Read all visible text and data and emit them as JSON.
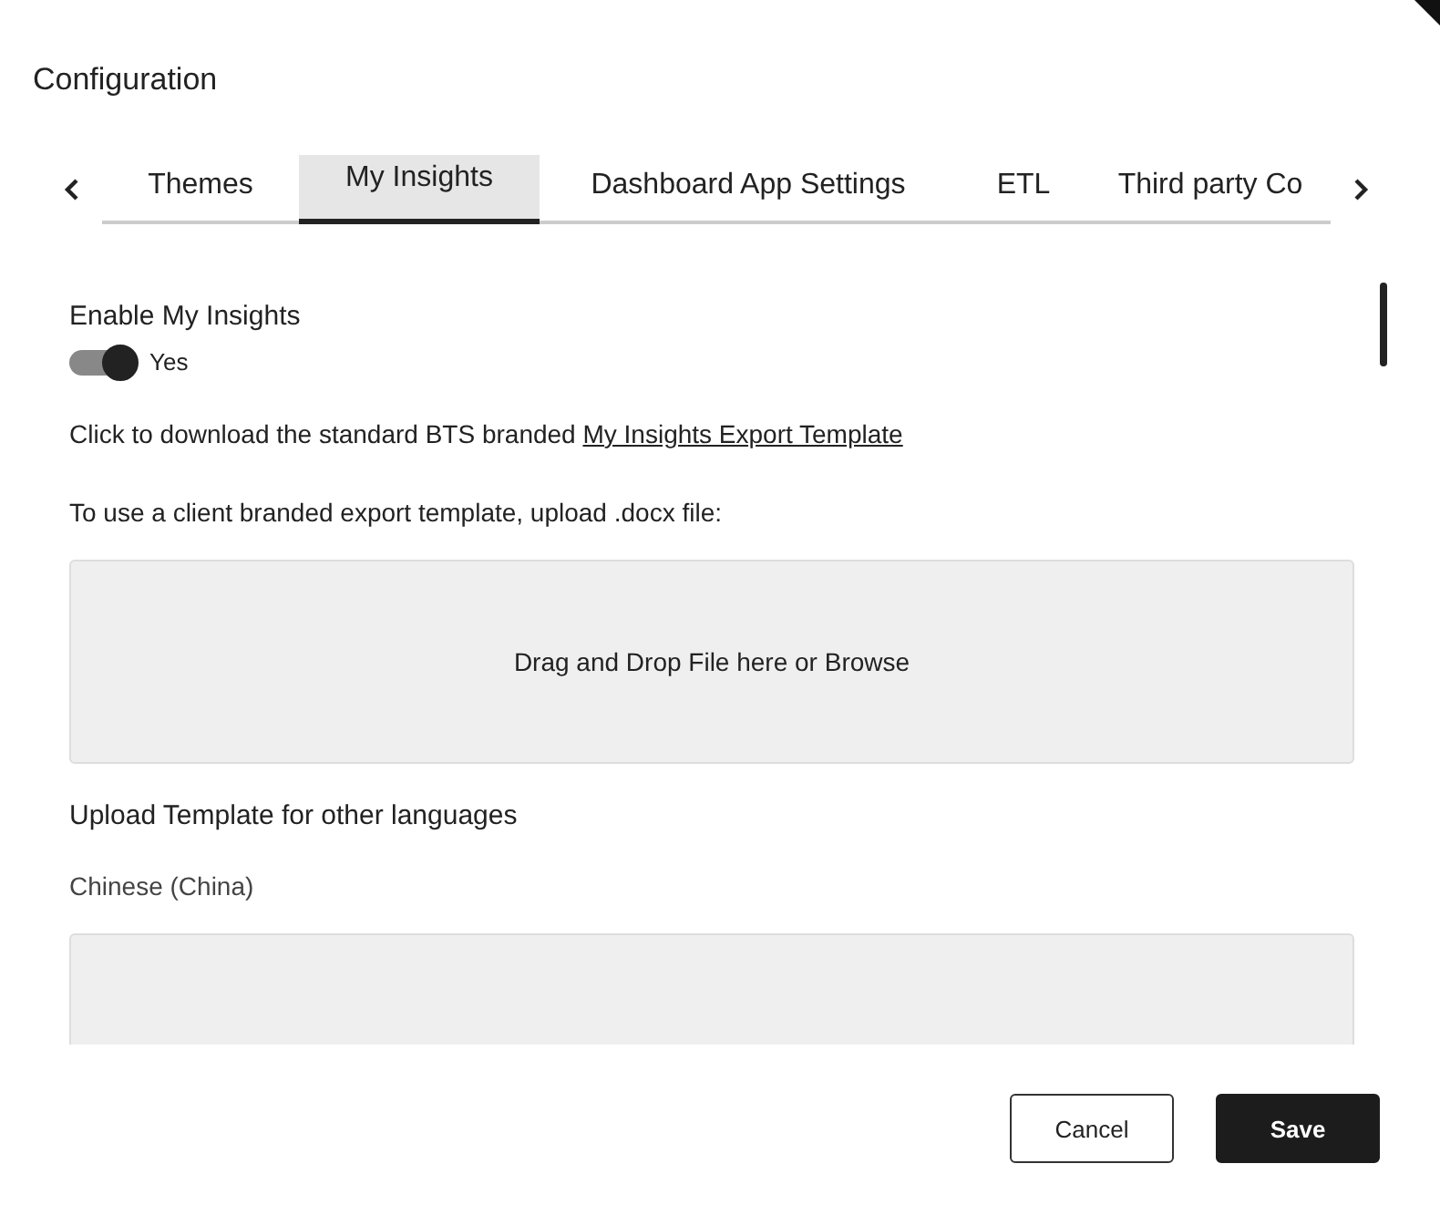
{
  "dialog": {
    "title": "Configuration"
  },
  "tabs": [
    {
      "label": "Themes",
      "selected": false
    },
    {
      "label": "My Insights",
      "selected": true
    },
    {
      "label": "Dashboard App Settings",
      "selected": false
    },
    {
      "label": "ETL",
      "selected": false
    },
    {
      "label": "Third party Co",
      "selected": false
    }
  ],
  "enable": {
    "label": "Enable My Insights",
    "on": true,
    "state_label": "Yes"
  },
  "download": {
    "text": "Click to download the standard BTS branded",
    "link": "My Insights Export Template"
  },
  "upload": {
    "label": "To use a client branded export template, upload .docx file:",
    "dropzone": "Drag and Drop File here or Browse"
  },
  "languages": {
    "heading": "Upload Template for other languages",
    "items": [
      {
        "language": "Chinese (China)"
      }
    ]
  },
  "buttons": [
    {
      "label": "Cancel",
      "kind": "secondary"
    },
    {
      "label": "Save",
      "kind": "primary"
    }
  ]
}
